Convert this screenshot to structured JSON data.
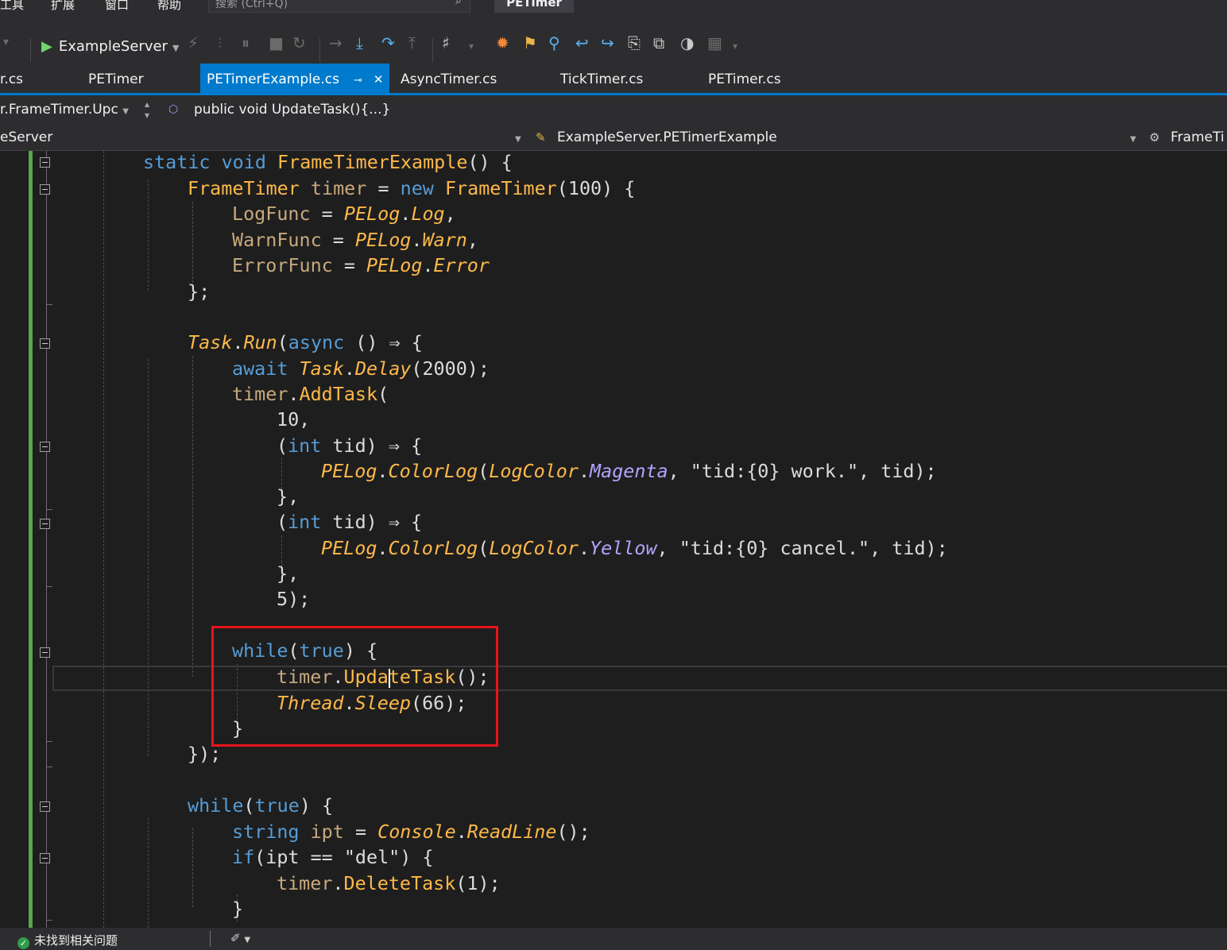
{
  "menu": {
    "items": [
      "工具",
      "扩展",
      "窗口",
      "帮助"
    ]
  },
  "search": {
    "placeholder": "搜索 (Ctrl+Q)"
  },
  "window_title": "PETimer",
  "toolbar": {
    "run_target": "ExampleServer"
  },
  "tabs": [
    {
      "label": "r.cs"
    },
    {
      "label": "PETimer"
    },
    {
      "label": "PETimerExample.cs",
      "active": true
    },
    {
      "label": "AsyncTimer.cs"
    },
    {
      "label": "TickTimer.cs"
    },
    {
      "label": "PETimer.cs"
    }
  ],
  "nav": {
    "scope": "r.FrameTimer.Upc",
    "member": "public void UpdateTask(){...}",
    "project": "eServer",
    "type": "ExampleServer.PETimerExample",
    "member2": "FrameTi"
  },
  "code": {
    "l1": [
      "static",
      "void",
      "FrameTimerExample",
      "() {"
    ],
    "l2": [
      "FrameTimer",
      "timer",
      "=",
      "new",
      "FrameTimer",
      "(100) {"
    ],
    "l3": [
      "LogFunc",
      "=",
      "PELog",
      ".",
      "Log",
      ","
    ],
    "l4": [
      "WarnFunc",
      "=",
      "PELog",
      ".",
      "Warn",
      ","
    ],
    "l5": [
      "ErrorFunc",
      "=",
      "PELog",
      ".",
      "Error"
    ],
    "l6": [
      "};"
    ],
    "l7": [
      "Task",
      ".",
      "Run",
      "(",
      "async",
      " () ⇒ {"
    ],
    "l8": [
      "await",
      "Task",
      ".",
      "Delay",
      "(2000);"
    ],
    "l9": [
      "timer",
      ".",
      "AddTask",
      "("
    ],
    "l10": [
      "10,"
    ],
    "l11": [
      "(",
      "int",
      " tid) ⇒ {"
    ],
    "l12": [
      "PELog",
      ".",
      "ColorLog",
      "(",
      "LogColor",
      ".",
      "Magenta",
      ", ",
      "\"tid:{0} work.\"",
      ", tid);"
    ],
    "l13": [
      "},"
    ],
    "l14": [
      "(",
      "int",
      " tid) ⇒ {"
    ],
    "l15": [
      "PELog",
      ".",
      "ColorLog",
      "(",
      "LogColor",
      ".",
      "Yellow",
      ", ",
      "\"tid:{0} cancel.\"",
      ", tid);"
    ],
    "l16": [
      "},"
    ],
    "l17": [
      "5);"
    ],
    "l18": [
      "while",
      "(",
      "true",
      ") {"
    ],
    "l19": [
      "timer",
      ".",
      "UpdateTask",
      "();"
    ],
    "l20": [
      "Thread",
      ".",
      "Sleep",
      "(66);"
    ],
    "l21": [
      "}"
    ],
    "l22": [
      "});"
    ],
    "l23": [
      "while",
      "(",
      "true",
      ") {"
    ],
    "l24": [
      "string",
      "ipt",
      "=",
      "Console",
      ".",
      "ReadLine",
      "();"
    ],
    "l25": [
      "if",
      "(ipt ",
      "==",
      " \"del\") {"
    ],
    "l26": [
      "timer",
      ".",
      "DeleteTask",
      "(1);"
    ],
    "l27": [
      "}"
    ]
  },
  "status": {
    "message": "未找到相关问题"
  },
  "colors": {
    "accent": "#007acc",
    "highlight_box": "#e8141b",
    "keyword": "#569cd6",
    "type": "#ffb94a",
    "change_bar": "#57a64a"
  }
}
